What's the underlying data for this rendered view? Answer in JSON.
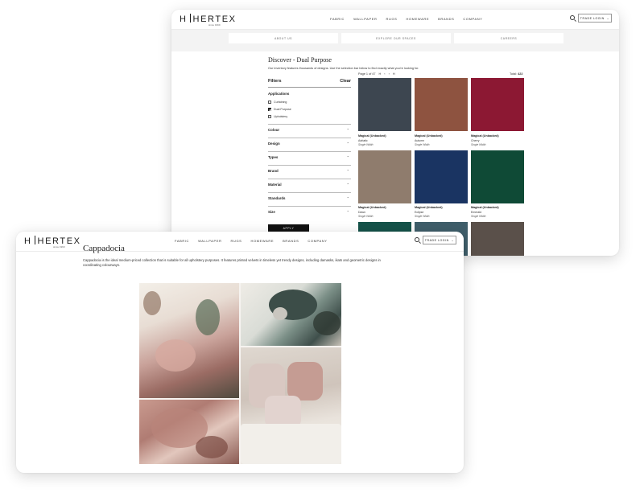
{
  "back": {
    "logo": {
      "text": "HERTEX",
      "since": "since 1969"
    },
    "nav": [
      "FABRIC",
      "WALLPAPER",
      "RUGS",
      "HOMEWARE",
      "BRANDS",
      "COMPANY"
    ],
    "trade_login": "TRADE LOGIN",
    "subnav": [
      "ABOUT US",
      "EXPLORE OUR SPACES",
      "CAREERS"
    ],
    "title": "Discover - Dual Purpose",
    "intro": "Our inventory features thousands of designs. Use the selection bar below to find exactly what you're looking for.",
    "filters": {
      "heading": "Filters",
      "clear": "Clear",
      "applications_title": "Applications",
      "applications": [
        {
          "label": "Curtaining",
          "checked": false
        },
        {
          "label": "Dual Purpose",
          "checked": true
        },
        {
          "label": "Upholstery",
          "checked": false
        }
      ],
      "sections": [
        "Colour",
        "Design",
        "Types",
        "Brand",
        "Material",
        "Standards",
        "Size"
      ],
      "apply": "APPLY"
    },
    "pager": {
      "text": "Page 1 of 47",
      "first": "H",
      "prev": "‹",
      "next": "›",
      "last": "H"
    },
    "total": {
      "label": "Total:",
      "value": "422"
    },
    "swatches": [
      {
        "name": "Magical (Unbacked)",
        "colour": "Adriatic",
        "width": "Single Width",
        "hex": "#3d4650"
      },
      {
        "name": "Magical (Unbacked)",
        "colour": "Autumn",
        "width": "Single Width",
        "hex": "#8e5340"
      },
      {
        "name": "Magical (Unbacked)",
        "colour": "Cherry",
        "width": "Single Width",
        "hex": "#8c1833"
      },
      {
        "name": "Magical (Unbacked)",
        "colour": "Dawn",
        "width": "Single Width",
        "hex": "#8f7c6d"
      },
      {
        "name": "Magical (Unbacked)",
        "colour": "Eclipse",
        "width": "Single Width",
        "hex": "#1a3462"
      },
      {
        "name": "Magical (Unbacked)",
        "colour": "Emerald",
        "width": "Single Width",
        "hex": "#0f4a36"
      },
      {
        "name": "",
        "colour": "",
        "width": "",
        "hex": "#155249"
      },
      {
        "name": "",
        "colour": "",
        "width": "",
        "hex": "#3f5e6a"
      },
      {
        "name": "",
        "colour": "",
        "width": "",
        "hex": "#5a504a"
      }
    ]
  },
  "front": {
    "logo": {
      "text": "HERTEX",
      "since": "since 1969"
    },
    "nav": [
      "FABRIC",
      "WALLPAPER",
      "RUGS",
      "HOMEWARE",
      "BRANDS",
      "COMPANY"
    ],
    "trade_login": "TRADE LOGIN",
    "title": "Cappadocia",
    "intro": "Cappadocia is the ideal medium-priced collection that is suitable for all upholstery purposes. It features printed velvets in timeless yet trendy designs, including damasks, ikats and geometric designs in coordinating colourways."
  }
}
